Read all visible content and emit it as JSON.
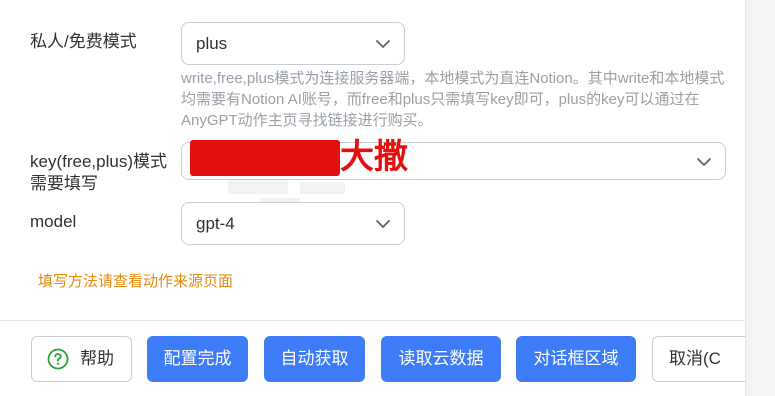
{
  "form": {
    "mode": {
      "label": "私人/免费模式",
      "value": "plus",
      "help": "write,free,plus模式为连接服务器端，本地模式为直连Notion。其中write和本地模式均需要有Notion AI账号，而free和plus只需填写key即可，plus的key可以通过在AnyGPT动作主页寻找链接进行购买。"
    },
    "key": {
      "label": "key(free,plus)模式需要填写",
      "redacted_suffix": "大撒"
    },
    "model": {
      "label": "model",
      "value": "gpt-4"
    },
    "note": "填写方法请查看动作来源页面"
  },
  "footer": {
    "help_label": "帮助",
    "config_done_label": "配置完成",
    "auto_fetch_label": "自动获取",
    "read_cloud_label": "读取云数据",
    "dialog_area_label": "对话框区域",
    "cancel_label": "取消(C"
  },
  "colors": {
    "primary": "#3d7cf6",
    "note_orange": "#e8890c",
    "redaction_red": "#e31010",
    "help_green": "#2e9e3e"
  },
  "icons": {
    "dropdown": "chevron-down-icon",
    "help": "question-circle-icon"
  }
}
